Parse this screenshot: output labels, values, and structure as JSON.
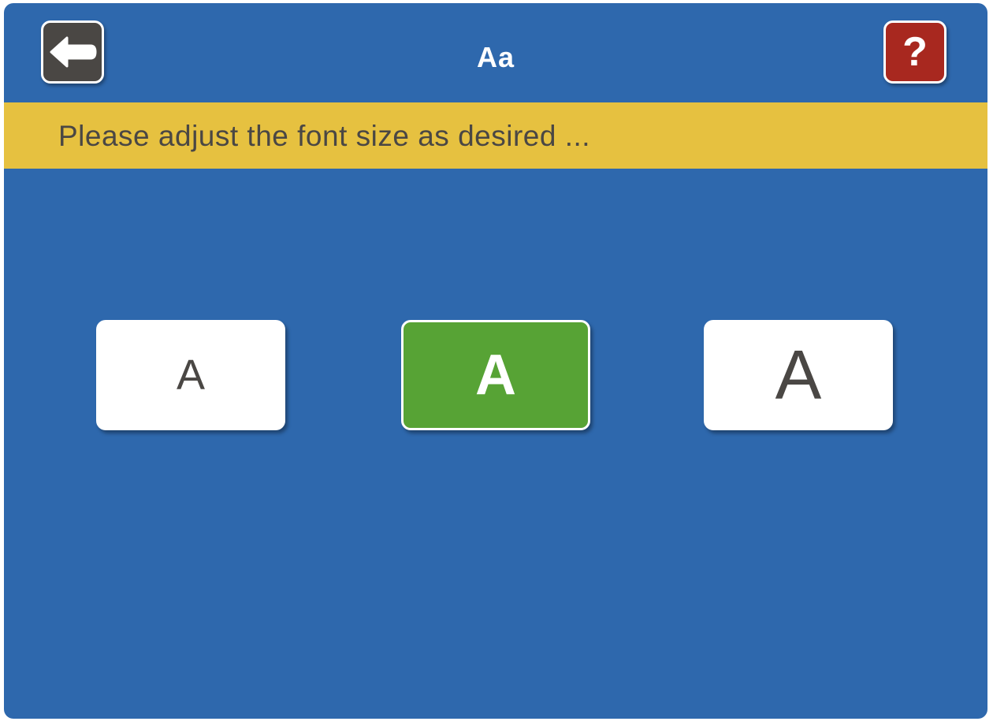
{
  "header": {
    "title": "Aa",
    "back_icon": "arrow-left-icon",
    "help_label": "?"
  },
  "banner": {
    "text": "Please adjust the font size as desired ..."
  },
  "font_sizes": {
    "options": [
      {
        "label": "A",
        "size": "small",
        "selected": false
      },
      {
        "label": "A",
        "size": "medium",
        "selected": true
      },
      {
        "label": "A",
        "size": "large",
        "selected": false
      }
    ]
  },
  "colors": {
    "background": "#2e68ad",
    "banner": "#e6c140",
    "back_button": "#4a4744",
    "help_button": "#a8281f",
    "selected": "#57a335",
    "text_dark": "#4a4744"
  }
}
